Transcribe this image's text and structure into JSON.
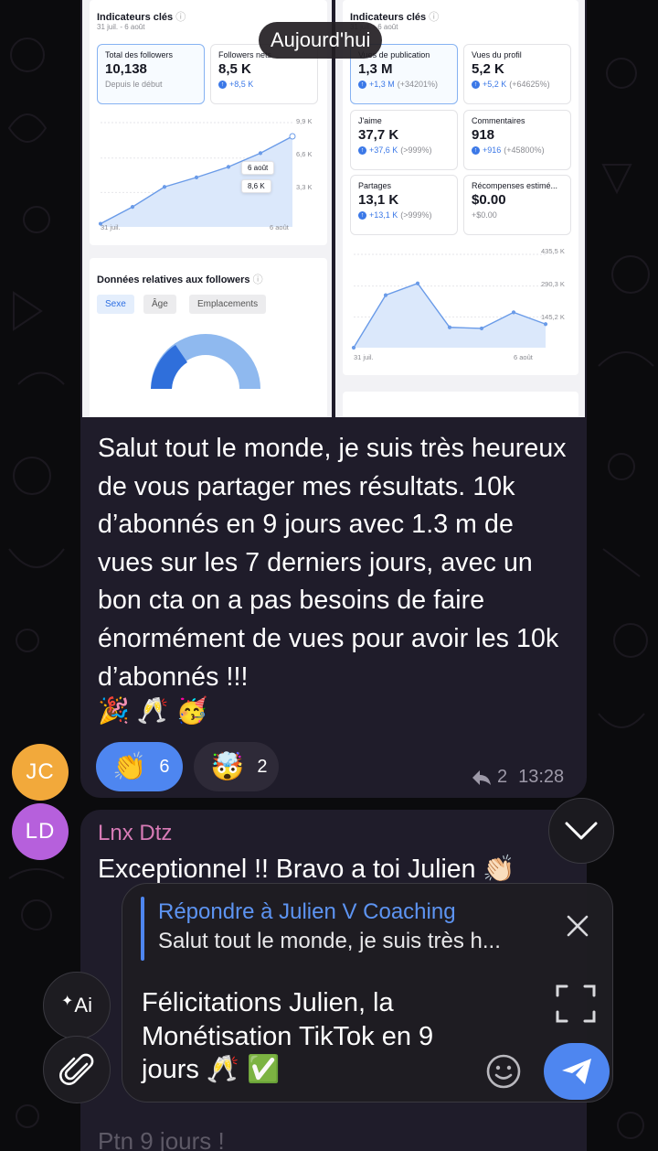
{
  "chat": {
    "date_pill": "Aujourd'hui",
    "message1": {
      "screenshot": {
        "left": {
          "title": "Indicateurs clés",
          "date_range": "31 juil. - 6 août",
          "tiles": [
            {
              "label": "Total des followers",
              "value": "10,138",
              "sub": "Depuis le début"
            },
            {
              "label": "Followers nets",
              "value": "8,5 K",
              "delta": "+8,5 K"
            }
          ],
          "chart_data": {
            "type": "area",
            "x_labels": [
              "31 juil.",
              "6 août"
            ],
            "y_ticks": [
              "9,9 K",
              "6,6 K",
              "3,3 K"
            ],
            "values": [
              0.3,
              1.9,
              3.8,
              4.7,
              5.7,
              7.0,
              8.6
            ],
            "tooltip_date": "6 août",
            "tooltip_value": "8,6 K"
          },
          "followers_section": {
            "title": "Données relatives aux followers",
            "tabs": [
              "Sexe",
              "Âge",
              "Emplacements"
            ]
          }
        },
        "right": {
          "title": "Indicateurs clés",
          "date_range": "31 juil. - 6 août",
          "tiles": [
            {
              "label": "Vues de publication",
              "value": "1,3 M",
              "delta": "+1,3 M",
              "pct": "(+34201%)"
            },
            {
              "label": "Vues du profil",
              "value": "5,2 K",
              "delta": "+5,2 K",
              "pct": "(+64625%)"
            },
            {
              "label": "J'aime",
              "value": "37,7 K",
              "delta": "+37,6 K",
              "pct": "(>999%)"
            },
            {
              "label": "Commentaires",
              "value": "918",
              "delta": "+916",
              "pct": "(+45800%)"
            },
            {
              "label": "Partages",
              "value": "13,1 K",
              "delta": "+13,1 K",
              "pct": "(>999%)"
            },
            {
              "label": "Récompenses estimé...",
              "value": "$0.00",
              "delta": "+$0.00"
            }
          ],
          "chart_data": {
            "type": "area",
            "x_labels": [
              "31 juil.",
              "6 août"
            ],
            "y_ticks": [
              "435,5 K",
              "290,3 K",
              "145,2 K"
            ],
            "values": [
              0,
              245,
              300,
              95,
              90,
              165,
              110
            ]
          }
        }
      },
      "text": "Salut tout le monde, je suis très heureux de vous partager mes résultats. 10k d’abonnés en 9 jours avec 1.3 m de vues sur les 7 derniers jours, avec un bon cta on a pas besoins de faire énormément de vues pour avoir les 10k d’abonnés !!!",
      "emojis": [
        "🎉",
        "🥂",
        "🥳"
      ],
      "reactions": [
        {
          "emoji": "👏",
          "count": "6"
        },
        {
          "emoji": "🤯",
          "count": "2"
        }
      ],
      "reply_count": "2",
      "time": "13:28"
    },
    "avatars": [
      {
        "initials": "JC",
        "color": "#f2a93b"
      },
      {
        "initials": "LD",
        "color": "#b660dc"
      }
    ],
    "message2": {
      "sender": "Lnx Dtz",
      "text": "Exceptionnel !! Bravo a toi Julien 👏🏻"
    },
    "faded_message": "Ptn 9 jours !"
  },
  "composer": {
    "reply_to_label": "Répondre à Julien V Coaching",
    "reply_preview": "Salut tout le monde, je suis très h...",
    "input_text": "Félicitations Julien, la Monétisation TikTok en 9 jours 🥂 ✅",
    "ai_button": "Ai",
    "accent_color": "#4e86f0"
  }
}
